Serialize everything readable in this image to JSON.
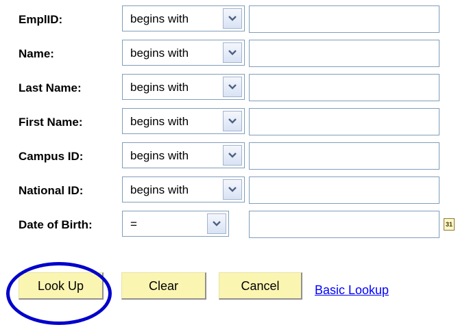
{
  "criteria": [
    {
      "label": "EmplID:",
      "operator": "begins with",
      "value": ""
    },
    {
      "label": "Name:",
      "operator": "begins with",
      "value": ""
    },
    {
      "label": "Last Name:",
      "operator": "begins with",
      "value": ""
    },
    {
      "label": "First Name:",
      "operator": "begins with",
      "value": ""
    },
    {
      "label": "Campus ID:",
      "operator": "begins with",
      "value": ""
    },
    {
      "label": "National ID:",
      "operator": "begins with",
      "value": ""
    }
  ],
  "dob": {
    "label": "Date of Birth:",
    "operator": "=",
    "value": "",
    "calendar_icon_text": "31"
  },
  "buttons": {
    "lookup": "Look Up",
    "clear": "Clear",
    "cancel": "Cancel"
  },
  "links": {
    "basic_lookup": "Basic Lookup"
  },
  "colors": {
    "button_bg": "#fbf5b2",
    "link": "#0000ff",
    "highlight": "#0000cc",
    "field_border": "#7f9db9"
  },
  "icons": {
    "dropdown": "chevron-down-icon",
    "calendar": "calendar-icon"
  }
}
